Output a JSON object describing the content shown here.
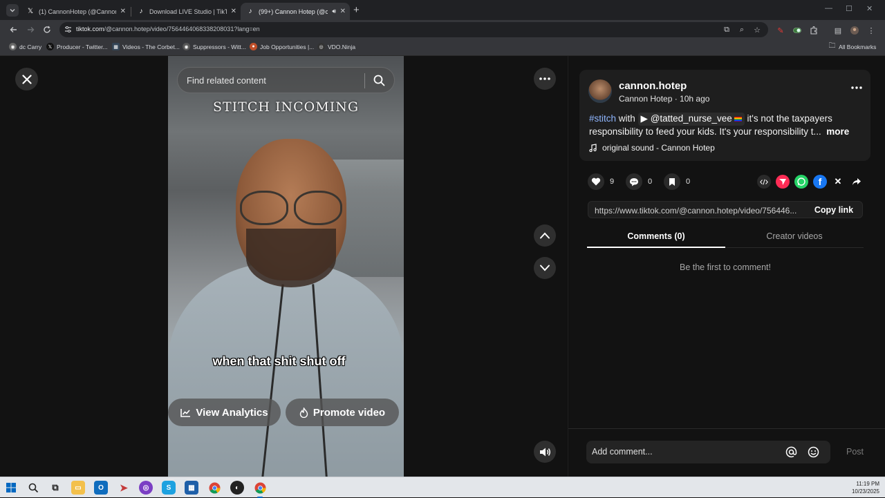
{
  "browser": {
    "tabs": [
      {
        "title": "(1) CannonHotep (@CannonHo",
        "icon": "x-logo-icon"
      },
      {
        "title": "Download LIVE Studio | TikTok",
        "icon": "tiktok-icon"
      },
      {
        "title": "(99+) Cannon Hotep (@can",
        "icon": "tiktok-icon",
        "active": true
      }
    ],
    "url_domain": "tiktok.com",
    "url_path": "/@cannon.hotep/video/7564464068338208031?lang=en",
    "bookmarks": [
      {
        "label": "dc Carry"
      },
      {
        "label": "Producer - Twitter..."
      },
      {
        "label": "Videos - The Corbet..."
      },
      {
        "label": "Suppressors - Witt..."
      },
      {
        "label": "Job Opportunities |..."
      },
      {
        "label": "VDO.Ninja"
      }
    ],
    "all_bookmarks": "All Bookmarks"
  },
  "video": {
    "search_placeholder": "Find related content",
    "overlay_title": "STITCH INCOMING",
    "caption": "when that shit shut off",
    "analytics_label": "View Analytics",
    "promote_label": "Promote video"
  },
  "post": {
    "handle": "cannon.hotep",
    "subline": "Cannon Hotep · 10h ago",
    "hashtag": "#stitch",
    "with_text": " with ",
    "mention": "@tatted_nurse_vee",
    "desc_text": " it's not the taxpayers responsibility to feed your kids. It's your responsibility t...",
    "more_label": "more",
    "sound": "original sound - Cannon Hotep",
    "likes": "9",
    "comments": "0",
    "saves": "0",
    "link": "https://www.tiktok.com/@cannon.hotep/video/756446...",
    "copy_label": "Copy link",
    "tab_comments": "Comments (0)",
    "tab_creator": "Creator videos",
    "empty_text": "Be the first to comment!",
    "comment_placeholder": "Add comment...",
    "post_label": "Post"
  },
  "colors": {
    "hashtag": "#8fb6ff",
    "share_red": "#fe2c55",
    "whatsapp": "#25d366",
    "facebook": "#1877f2"
  },
  "taskbar": {
    "time": "11:19 PM",
    "date": "10/23/2025"
  }
}
